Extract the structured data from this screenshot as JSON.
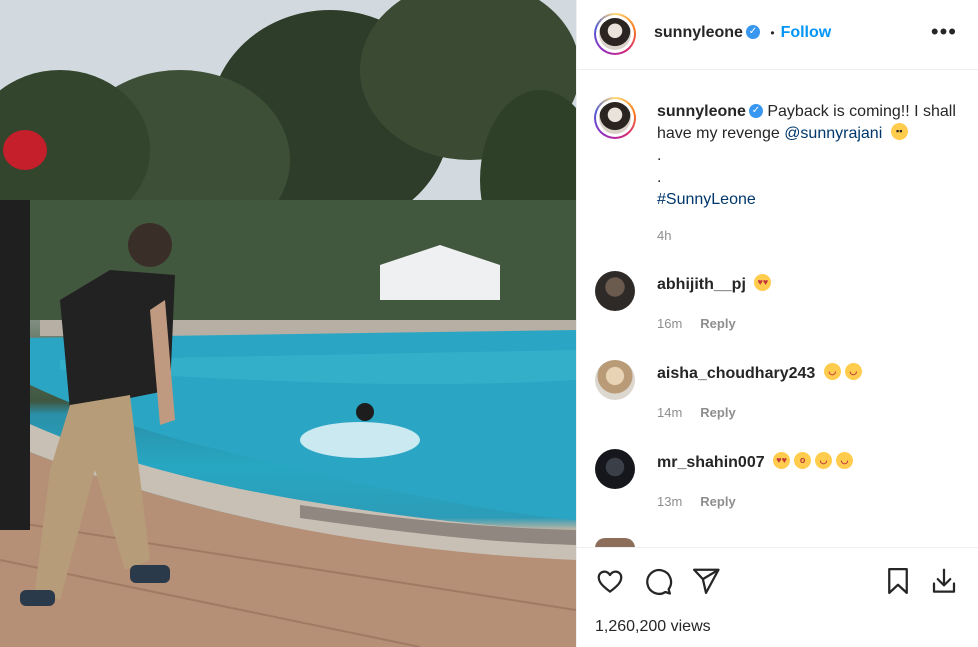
{
  "post": {
    "author": "sunnyleone",
    "follow_label": "Follow",
    "separator": "•",
    "more_label": "•••",
    "caption": {
      "username": "sunnyleone",
      "text": "Payback is coming!! I shall have my revenge",
      "mention": "@sunnyrajani",
      "emoji": "sunglasses-emoji",
      "dot1": ".",
      "dot2": ".",
      "hashtag": "#SunnyLeone",
      "time": "4h"
    }
  },
  "comments": [
    {
      "username": "abhijith__pj",
      "emojis": [
        "heart-eyes-emoji"
      ],
      "time": "16m",
      "reply": "Reply"
    },
    {
      "username": "aisha_choudhary243",
      "emojis": [
        "tears-of-joy-emoji",
        "tears-of-joy-emoji"
      ],
      "time": "14m",
      "reply": "Reply"
    },
    {
      "username": "mr_shahin007",
      "emojis": [
        "heart-eyes-emoji",
        "astonished-emoji",
        "tears-of-joy-emoji",
        "tears-of-joy-emoji"
      ],
      "time": "13m",
      "reply": "Reply"
    }
  ],
  "footer": {
    "views": "1,260,200 views"
  },
  "colors": {
    "accent": "#0095f6",
    "verified": "#3897f0",
    "meta": "#8e8e8e",
    "link": "#00376b"
  }
}
